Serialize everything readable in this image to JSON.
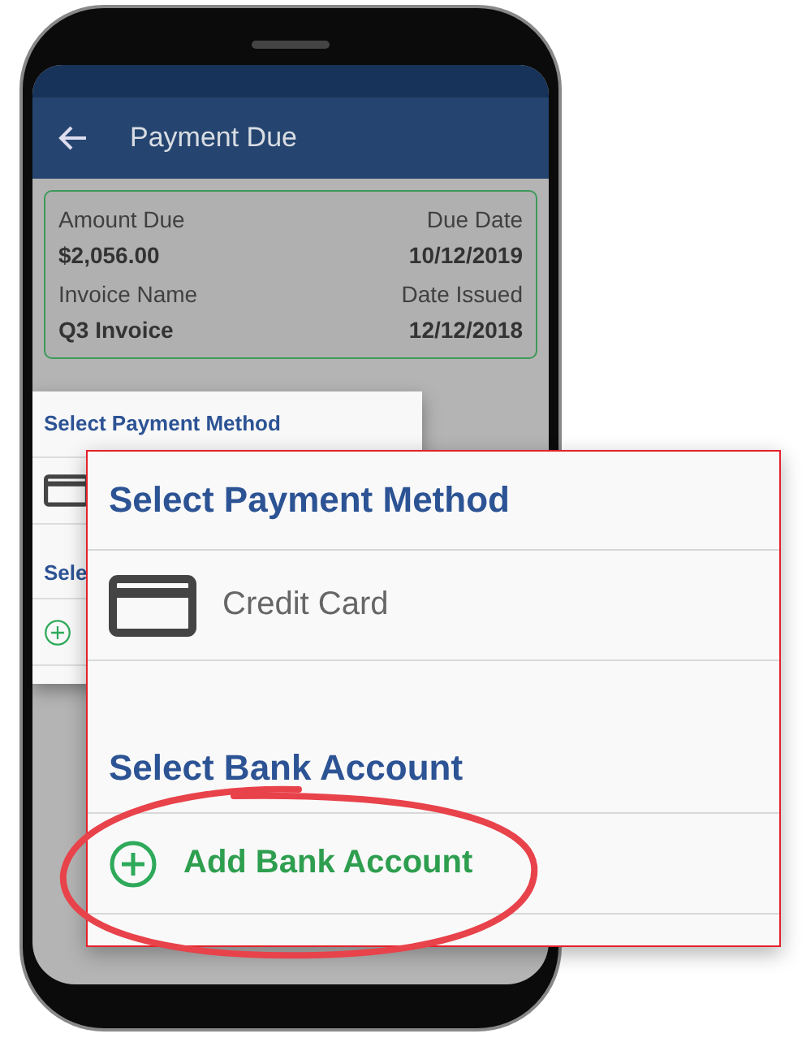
{
  "app_bar": {
    "title": "Payment Due"
  },
  "invoice": {
    "fields": [
      {
        "label": "Amount Due",
        "value": "$2,056.00"
      },
      {
        "label": "Due Date",
        "value": "10/12/2019"
      },
      {
        "label": "Invoice Name",
        "value": "Q3 Invoice"
      },
      {
        "label": "Date Issued",
        "value": "12/12/2018"
      }
    ]
  },
  "sheet": {
    "payment_heading": "Select Payment Method",
    "bank_heading": "Sele"
  },
  "callout": {
    "payment_heading": "Select Payment Method",
    "methods": [
      {
        "label": "Credit Card"
      }
    ],
    "bank_heading": "Select Bank Account",
    "add_action": "Add Bank Account"
  }
}
